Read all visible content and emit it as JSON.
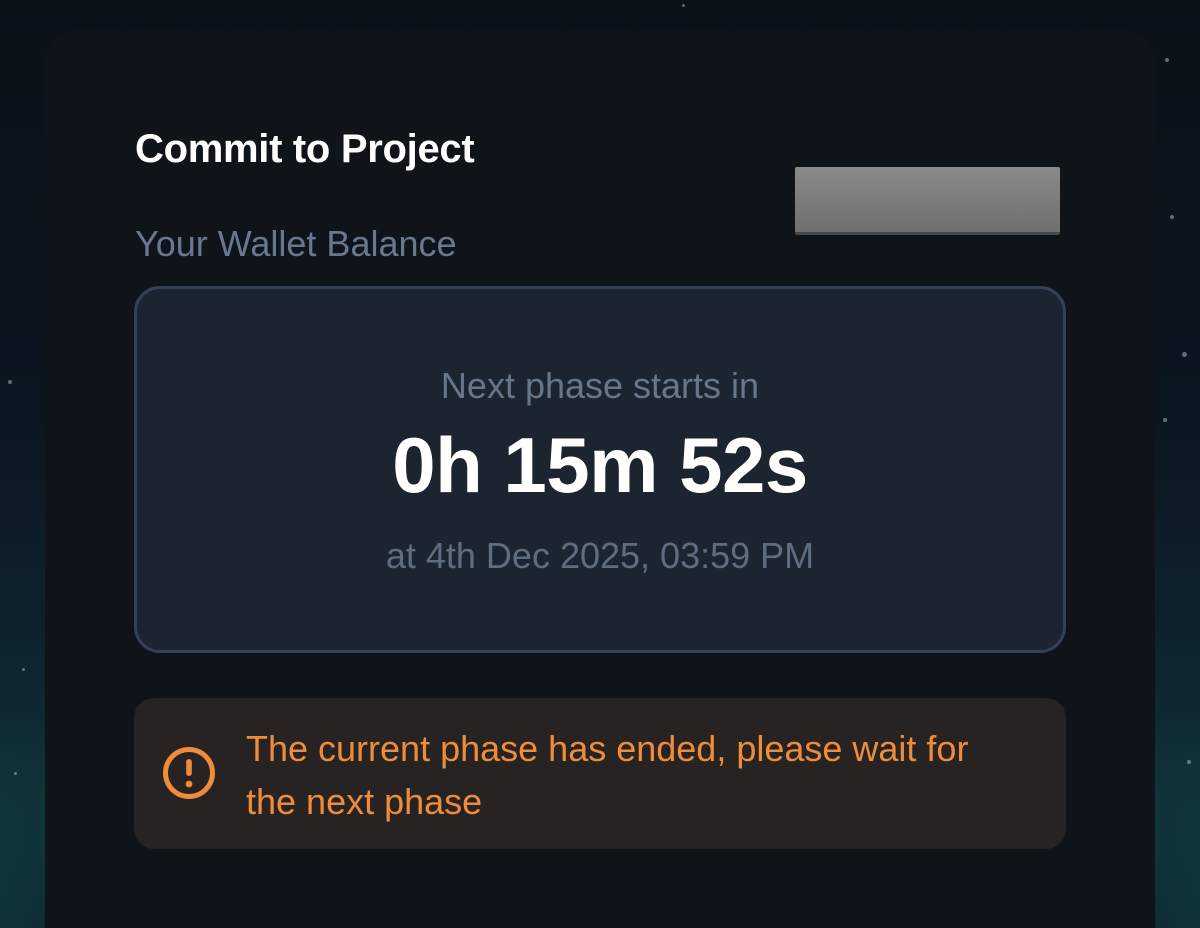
{
  "card": {
    "title": "Commit to Project",
    "wallet_balance_label": "Your Wallet Balance"
  },
  "countdown": {
    "label": "Next phase starts in",
    "time": "0h 15m 52s",
    "date": "at 4th Dec 2025, 03:59 PM"
  },
  "alert": {
    "icon": "exclamation-circle-icon",
    "message": "The current phase has ended, please wait for the next phase"
  },
  "colors": {
    "card_bg": "#0f141b",
    "countdown_bg": "#1c2430",
    "countdown_border": "#344257",
    "alert_bg": "#272323",
    "alert_accent": "#ee8c3a",
    "muted_text": "#69788c"
  }
}
